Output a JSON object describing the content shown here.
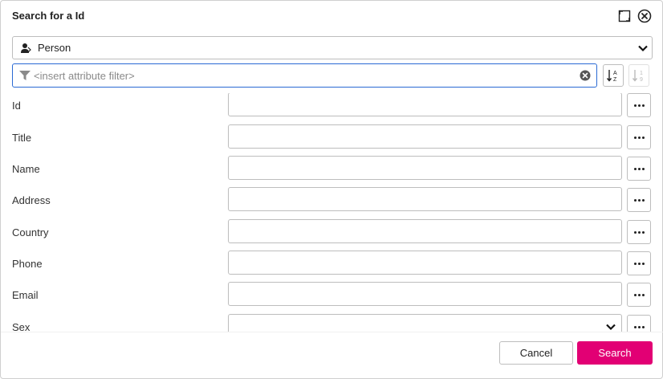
{
  "dialog": {
    "title": "Search for a Id"
  },
  "type_selector": {
    "value": "Person",
    "icon": "person-icon"
  },
  "filter": {
    "placeholder": "<insert attribute filter>",
    "value": ""
  },
  "sort_buttons": [
    {
      "name": "sort-a-z",
      "icon": "sort-alpha-icon"
    },
    {
      "name": "sort-1-9",
      "icon": "sort-numeric-icon"
    }
  ],
  "fields": [
    {
      "label": "Id",
      "value": ""
    },
    {
      "label": "Title",
      "value": ""
    },
    {
      "label": "Name",
      "value": ""
    },
    {
      "label": "Address",
      "value": ""
    },
    {
      "label": "Country",
      "value": ""
    },
    {
      "label": "Phone",
      "value": ""
    },
    {
      "label": "Email",
      "value": ""
    },
    {
      "label": "Sex",
      "value": ""
    }
  ],
  "footer": {
    "cancel_label": "Cancel",
    "search_label": "Search"
  },
  "colors": {
    "accent": "#e20074",
    "focus": "#2a6ad4"
  }
}
